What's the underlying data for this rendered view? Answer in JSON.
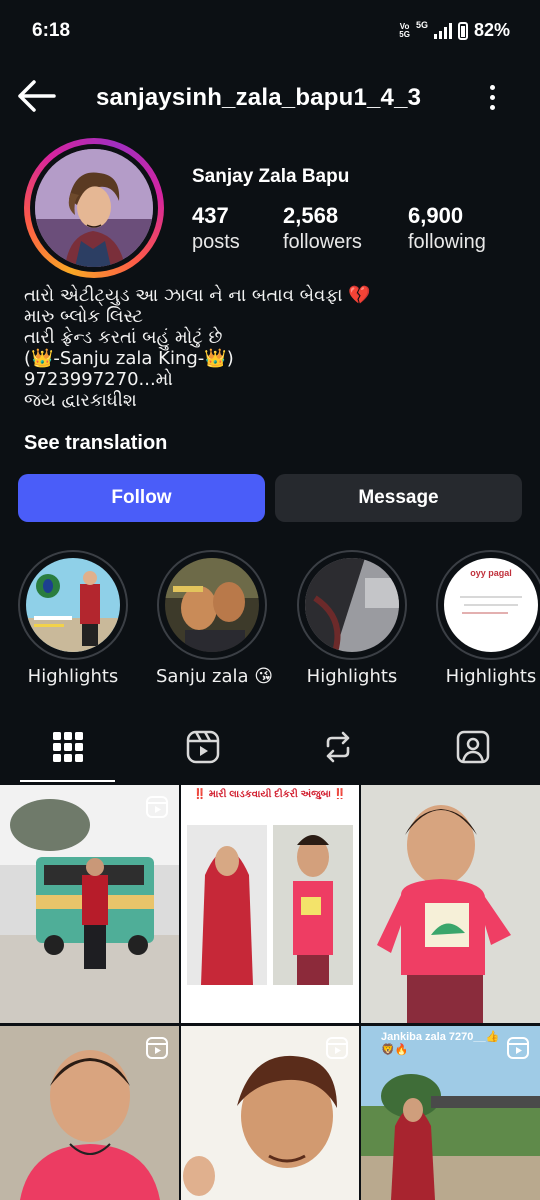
{
  "status_bar": {
    "time": "6:18",
    "volte": "Vo\n5G",
    "network": "5G",
    "battery": "82%"
  },
  "header": {
    "back_icon": "arrow-left-icon",
    "username": "sanjaysinh_zala_bapu1_4_3",
    "more_icon": "more-vertical-icon"
  },
  "profile": {
    "full_name": "Sanjay Zala Bapu",
    "stats": [
      {
        "value": "437",
        "label": "posts"
      },
      {
        "value": "2,568",
        "label": "followers"
      },
      {
        "value": "6,900",
        "label": "following"
      }
    ],
    "bio_lines": [
      "તારો એટીટ્યુડ આ ઝાલા ને ના બતાવ બેવફા 💔",
      "મારુ બ્લોક લિસ્ટ",
      "તારી ફ્રેન્ડ કરતાં બહું મોટું છે",
      "(👑-Sanju zala King-👑)",
      "9723997270...મો",
      "જય દ્વારકાધીશ"
    ],
    "see_translation": "See translation"
  },
  "actions": {
    "follow": "Follow",
    "message": "Message"
  },
  "highlights": [
    {
      "label": "Highlights"
    },
    {
      "label": "Sanju zala 😘"
    },
    {
      "label": "Highlights"
    },
    {
      "label": "Highlights",
      "image_text": "oyy pagal"
    }
  ],
  "tabs": [
    {
      "name": "posts-grid-icon",
      "active": true
    },
    {
      "name": "reels-icon",
      "active": false
    },
    {
      "name": "reposts-icon",
      "active": false
    },
    {
      "name": "tagged-icon",
      "active": false
    }
  ],
  "posts": [
    {
      "type": "reel",
      "caption": ""
    },
    {
      "type": "reel",
      "caption": "‼️ મારી લાડકવાયી દીકરી અંજુબા ‼️"
    },
    {
      "type": "photo",
      "caption": ""
    },
    {
      "type": "reel",
      "caption": ""
    },
    {
      "type": "reel",
      "caption": ""
    },
    {
      "type": "reel",
      "caption": "Jankiba zala 7270__👍🦁🔥"
    }
  ],
  "colors": {
    "background": "#0c1014",
    "follow_button": "#4a5df9",
    "message_button": "#26292e",
    "text": "#f5f5f5"
  }
}
